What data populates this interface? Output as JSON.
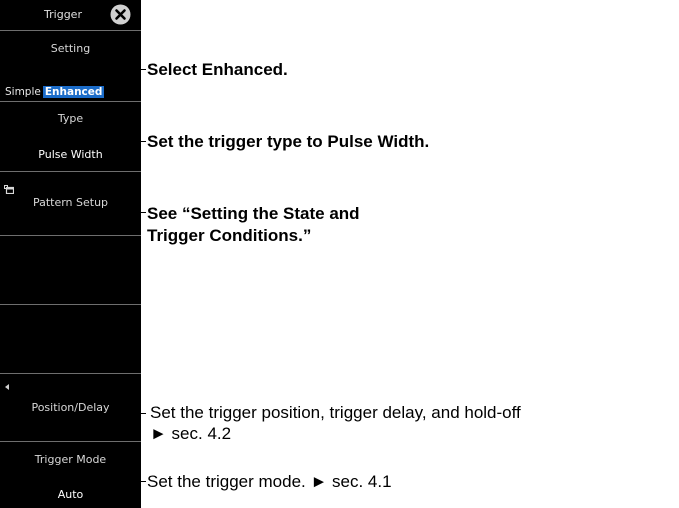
{
  "panel": {
    "title": "Trigger",
    "setting": {
      "label": "Setting",
      "options": [
        "Simple",
        "Enhanced"
      ],
      "selected": "Enhanced"
    },
    "type": {
      "label": "Type",
      "value": "Pulse Width"
    },
    "pattern_setup": {
      "label": "Pattern Setup"
    },
    "position_delay": {
      "label": "Position/Delay"
    },
    "trigger_mode": {
      "label": "Trigger Mode",
      "value": "Auto"
    }
  },
  "callouts": {
    "setting": "Select Enhanced.",
    "type": "Set the trigger type to Pulse Width.",
    "pattern_line1": "See “Setting the State and",
    "pattern_line2": "Trigger Conditions.”",
    "position_line1": "Set the trigger position, trigger delay, and hold-off",
    "position_line2": "► sec. 4.2",
    "mode": "Set the trigger mode. ► sec. 4.1"
  },
  "colors": {
    "panel_bg": "#000000",
    "selected_bg": "#1b6cc9",
    "divider": "#6e6e6e"
  }
}
